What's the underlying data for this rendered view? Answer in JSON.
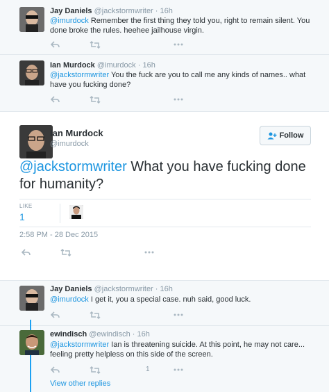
{
  "tweets": [
    {
      "name": "Jay Daniels",
      "handle": "@jackstormwriter",
      "dot": "·",
      "time": "16h",
      "mention": "@imurdock",
      "text": " Remember the first thing they told you, right to remain silent. You done broke the rules. heehee jailhouse virgin."
    },
    {
      "name": "Ian Murdock",
      "handle": "@imurdock",
      "dot": "·",
      "time": "16h",
      "mention": "@jackstormwriter",
      "text": " You the fuck are you to call me any kinds of names.. what have you fucking done?"
    }
  ],
  "focus": {
    "name": "Ian Murdock",
    "handle": "@imurdock",
    "follow_label": "Follow",
    "mention": "@jackstormwriter",
    "text": " What you have fucking done for humanity?",
    "likes_label": "LIKE",
    "likes_count": "1",
    "timestamp": "2:58 PM - 28 Dec 2015"
  },
  "replies": [
    {
      "name": "Jay Daniels",
      "handle": "@jackstormwriter",
      "dot": "·",
      "time": "16h",
      "mention": "@imurdock",
      "text": " I get it, you a special case. nuh said, good luck."
    },
    {
      "name": "ewindisch",
      "handle": "@ewindisch",
      "dot": "·",
      "time": "16h",
      "mention": "@jackstormwriter",
      "text": " Ian is threatening suicide. At this point, he may not care... feeling pretty helpless on this side of the screen.",
      "like_count": "1"
    }
  ],
  "view_other_replies": "View other replies",
  "icons": {
    "reply": "reply-icon",
    "retweet": "retweet-icon",
    "more": "more-icon",
    "follow": "add-user-icon"
  },
  "colors": {
    "link": "#1b95e0",
    "thread_line": "#1da1f2",
    "muted": "#8899a6",
    "band": "#f5f8fa"
  }
}
